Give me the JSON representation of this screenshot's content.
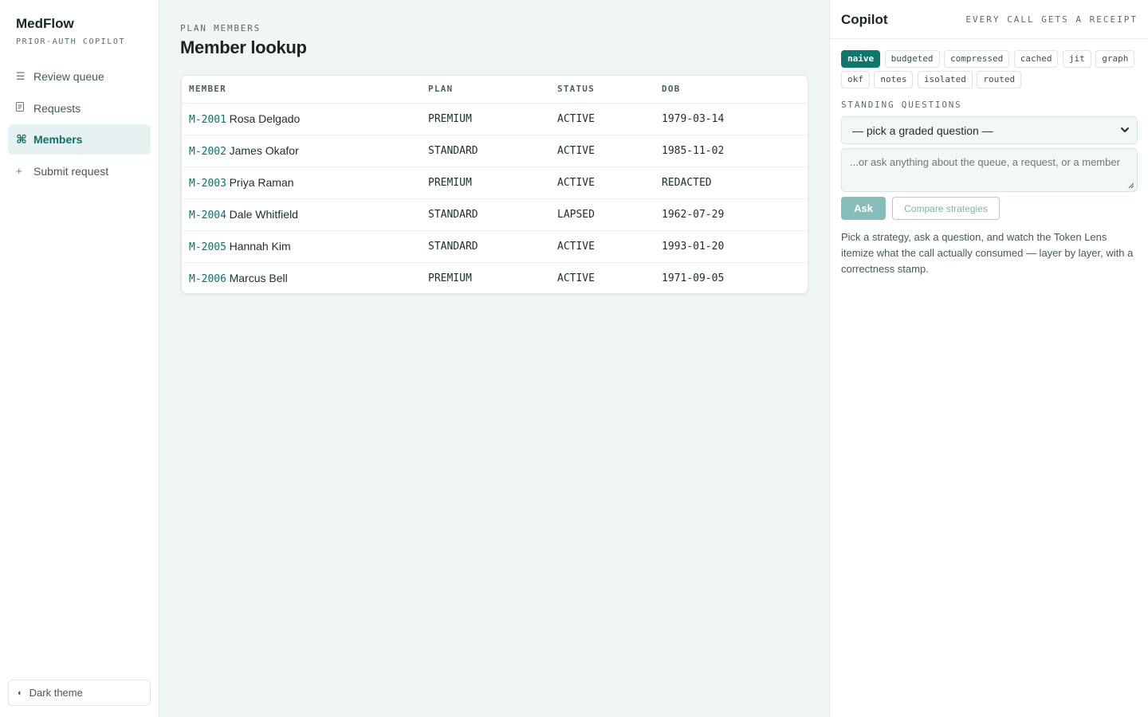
{
  "brand": {
    "title": "MedFlow",
    "subtitle": "PRIOR-AUTH COPILOT"
  },
  "sidebar": {
    "items": [
      {
        "label": "Review queue",
        "icon": "list-icon"
      },
      {
        "label": "Requests",
        "icon": "document-icon"
      },
      {
        "label": "Members",
        "icon": "command-icon",
        "active": true
      },
      {
        "label": "Submit request",
        "icon": "plus-icon"
      }
    ],
    "theme_toggle": "Dark theme"
  },
  "main": {
    "eyebrow": "PLAN MEMBERS",
    "title": "Member lookup",
    "columns": [
      "MEMBER",
      "PLAN",
      "STATUS",
      "DOB"
    ],
    "rows": [
      {
        "id": "M-2001",
        "name": "Rosa Delgado",
        "plan": "PREMIUM",
        "status": "ACTIVE",
        "dob": "1979-03-14"
      },
      {
        "id": "M-2002",
        "name": "James Okafor",
        "plan": "STANDARD",
        "status": "ACTIVE",
        "dob": "1985-11-02"
      },
      {
        "id": "M-2003",
        "name": "Priya Raman",
        "plan": "PREMIUM",
        "status": "ACTIVE",
        "dob": "REDACTED"
      },
      {
        "id": "M-2004",
        "name": "Dale Whitfield",
        "plan": "STANDARD",
        "status": "LAPSED",
        "dob": "1962-07-29"
      },
      {
        "id": "M-2005",
        "name": "Hannah Kim",
        "plan": "STANDARD",
        "status": "ACTIVE",
        "dob": "1993-01-20"
      },
      {
        "id": "M-2006",
        "name": "Marcus Bell",
        "plan": "PREMIUM",
        "status": "ACTIVE",
        "dob": "1971-09-05"
      }
    ]
  },
  "copilot": {
    "title": "Copilot",
    "tagline": "EVERY CALL GETS A RECEIPT",
    "strategies": [
      "naive",
      "budgeted",
      "compressed",
      "cached",
      "jit",
      "graph",
      "okf",
      "notes",
      "isolated",
      "routed"
    ],
    "active_strategy": "naive",
    "standing_label": "STANDING QUESTIONS",
    "select_value": "— pick a graded question —",
    "ask_placeholder": "...or ask anything about the queue, a request, or a member",
    "ask_label": "Ask",
    "compare_label": "Compare strategies",
    "help_text": "Pick a strategy, ask a question, and watch the Token Lens itemize what the call actually consumed — layer by layer, with a correctness stamp."
  },
  "colors": {
    "accent": "#0f766e",
    "accent_light": "#e6f2f1",
    "background": "#f1f5f5"
  }
}
